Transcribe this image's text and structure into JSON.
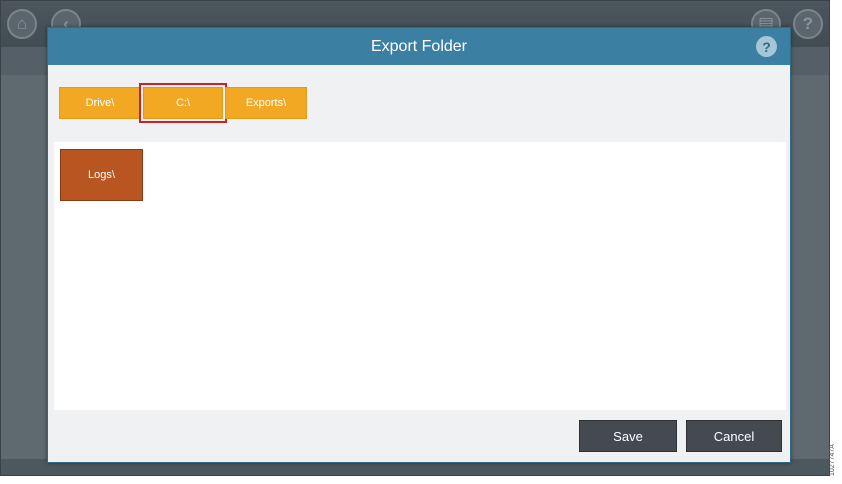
{
  "background": {
    "title": "",
    "icons": [
      "home-icon",
      "back-icon",
      "print-icon",
      "help-icon"
    ]
  },
  "dialog": {
    "title": "Export Folder",
    "help_label": "?",
    "breadcrumbs": [
      {
        "label": "Drive\\"
      },
      {
        "label": "C:\\",
        "selected": true
      },
      {
        "label": "Exports\\"
      }
    ],
    "folders": [
      {
        "label": "Logs\\"
      }
    ],
    "save_label": "Save",
    "cancel_label": "Cancel"
  },
  "side_tag": "1027747A",
  "colors": {
    "header": "#3b7fa3",
    "breadcrumb": "#f3a823",
    "folder": "#b85520",
    "selection_outline": "#c8232c",
    "button": "#444a4f"
  }
}
